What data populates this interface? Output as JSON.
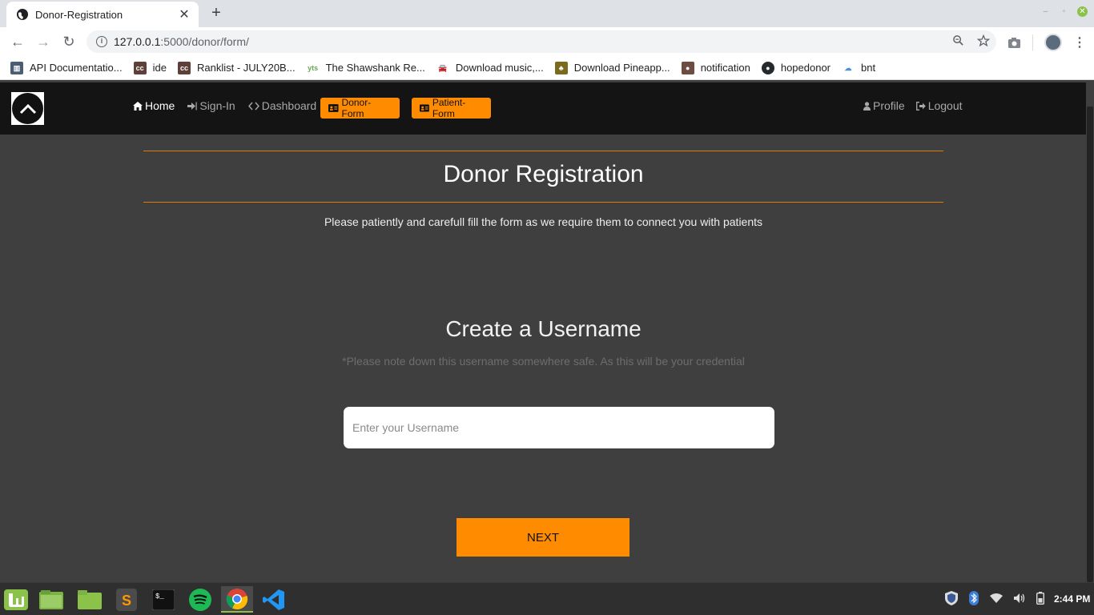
{
  "browser": {
    "tab_title": "Donor-Registration",
    "tab_close": "✕",
    "new_tab": "+",
    "url_host": "127.0.0.1",
    "url_path": ":5000/donor/form/",
    "bookmarks": [
      {
        "label": "API Documentatio...",
        "icon": "book-icon",
        "color": "#4a5d73"
      },
      {
        "label": "ide",
        "icon": "codechef-icon",
        "color": "#5d4037"
      },
      {
        "label": "Ranklist - JULY20B...",
        "icon": "codechef-icon",
        "color": "#5d4037"
      },
      {
        "label": "The Shawshank Re...",
        "icon": "yts-icon",
        "color": "#6aa84f"
      },
      {
        "label": "Download music,...",
        "icon": "car-icon",
        "color": "#333333"
      },
      {
        "label": "Download Pineapp...",
        "icon": "pineapple-icon",
        "color": "#7a6a1e"
      },
      {
        "label": "notification",
        "icon": "photo-icon",
        "color": "#6d4c41"
      },
      {
        "label": "hopedonor",
        "icon": "github-icon",
        "color": "#24292e"
      },
      {
        "label": "bnt",
        "icon": "cloud-icon",
        "color": "#4a90d9"
      }
    ]
  },
  "site_nav": {
    "home": "Home",
    "signin": "Sign-In",
    "dashboard": "Dashboard",
    "donor_form": "Donor-Form",
    "patient_form": "Patient-Form",
    "profile": "Profile",
    "logout": "Logout"
  },
  "page": {
    "title": "Donor Registration",
    "subtitle": "Please patiently and carefull fill the form as we require them to connect you with patients",
    "step_title": "Create a Username",
    "step_note": "*Please note down this username somewhere safe. As this will be your credential",
    "username_placeholder": "Enter your Username",
    "next_label": "NEXT"
  },
  "taskbar": {
    "clock": "2:44 PM",
    "apps": [
      "mint-menu-icon",
      "files-icon",
      "folder-icon",
      "sublime-text-icon",
      "terminal-icon",
      "spotify-icon",
      "chrome-icon",
      "vscode-icon"
    ]
  },
  "colors": {
    "accent": "#ff8c00",
    "page_bg": "#3f3f3f",
    "nav_bg": "#141414"
  }
}
